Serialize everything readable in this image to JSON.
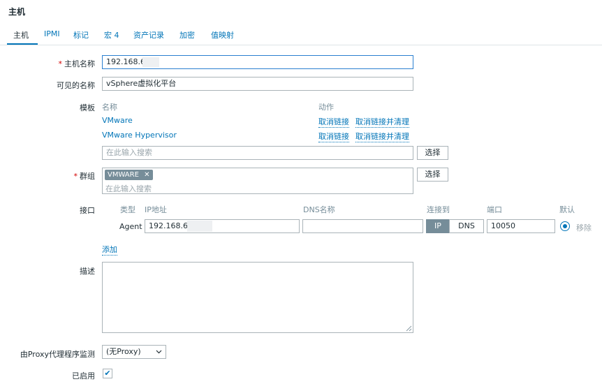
{
  "page": {
    "title": "主机"
  },
  "tabs": [
    {
      "label": "主机"
    },
    {
      "label": "IPMI"
    },
    {
      "label": "标记"
    },
    {
      "label": "宏 4"
    },
    {
      "label": "资产记录"
    },
    {
      "label": "加密"
    },
    {
      "label": "值映射"
    }
  ],
  "form": {
    "hostname": {
      "label": "主机名称",
      "value": "192.168.6"
    },
    "visible_name": {
      "label": "可见的名称",
      "value": "vSphere虚拟化平台"
    },
    "templates": {
      "label": "模板",
      "col_name": "名称",
      "col_action": "动作",
      "items": [
        {
          "name": "VMware",
          "unlink": "取消链接",
          "unlink_clear": "取消链接并清理"
        },
        {
          "name": "VMware Hypervisor",
          "unlink": "取消链接",
          "unlink_clear": "取消链接并清理"
        }
      ],
      "search_placeholder": "在此输入搜索",
      "select_button": "选择"
    },
    "groups": {
      "label": "群组",
      "tag": "VMWARE",
      "tag_remove": "✕",
      "search_placeholder": "在此输入搜索",
      "select_button": "选择"
    },
    "interfaces": {
      "label": "接口",
      "col_type": "类型",
      "col_ip": "IP地址",
      "col_dns": "DNS名称",
      "col_connect": "连接到",
      "col_port": "端口",
      "col_default": "默认",
      "row": {
        "type": "Agent",
        "ip": "192.168.6",
        "dns": "",
        "connect_ip": "IP",
        "connect_dns": "DNS",
        "port": "10050",
        "remove": "移除"
      },
      "add": "添加"
    },
    "description": {
      "label": "描述",
      "value": ""
    },
    "proxy": {
      "label": "由Proxy代理程序监测",
      "value": "(无Proxy)"
    },
    "enabled": {
      "label": "已启用",
      "checked": true,
      "check_glyph": "✔"
    }
  }
}
